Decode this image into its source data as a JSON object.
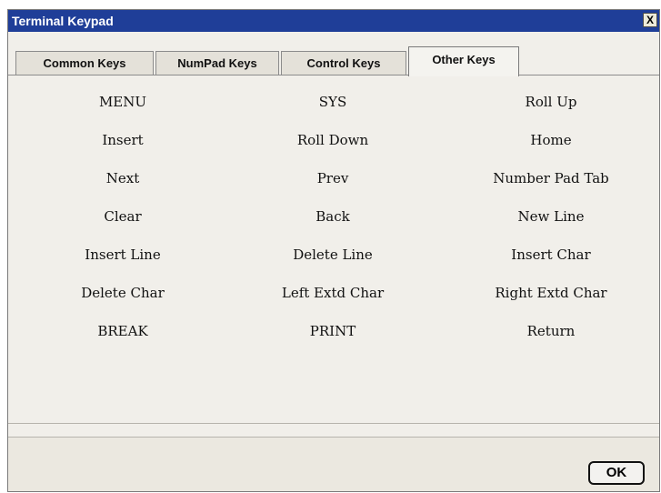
{
  "window": {
    "title": "Terminal Keypad",
    "close_label": "X"
  },
  "tabs": [
    {
      "label": "Common Keys",
      "active": false
    },
    {
      "label": "NumPad Keys",
      "active": false
    },
    {
      "label": "Control Keys",
      "active": false
    },
    {
      "label": "Other Keys",
      "active": true
    }
  ],
  "keys": [
    [
      "MENU",
      "SYS",
      "Roll Up"
    ],
    [
      "Insert",
      "Roll Down",
      "Home"
    ],
    [
      "Next",
      "Prev",
      "Number Pad Tab"
    ],
    [
      "Clear",
      "Back",
      "New Line"
    ],
    [
      "Insert Line",
      "Delete Line",
      "Insert Char"
    ],
    [
      "Delete Char",
      "Left Extd Char",
      "Right Extd Char"
    ],
    [
      "BREAK",
      "PRINT",
      "Return"
    ]
  ],
  "footer": {
    "ok_label": "OK"
  },
  "colors": {
    "titlebar": "#1f3e98",
    "panel": "#f1efea"
  }
}
